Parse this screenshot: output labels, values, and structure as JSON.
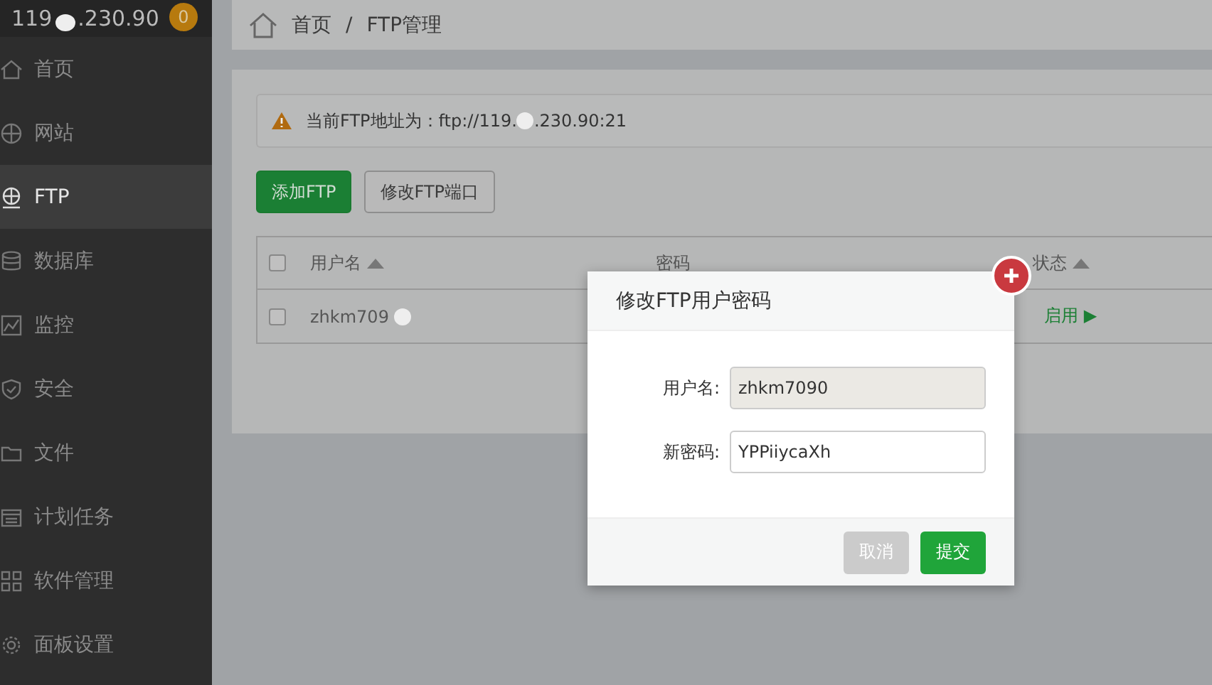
{
  "sidebar": {
    "host": {
      "ip_start": "119",
      "ip_end": ".230.90",
      "badge": "0"
    },
    "items": [
      {
        "label": "首页",
        "selected": false
      },
      {
        "label": "网站",
        "selected": false
      },
      {
        "label": "FTP",
        "selected": true
      },
      {
        "label": "数据库",
        "selected": false
      },
      {
        "label": "监控",
        "selected": false
      },
      {
        "label": "安全",
        "selected": false
      },
      {
        "label": "文件",
        "selected": false
      },
      {
        "label": "计划任务",
        "selected": false
      },
      {
        "label": "软件管理",
        "selected": false
      },
      {
        "label": "面板设置",
        "selected": false
      }
    ]
  },
  "breadcrumb": [
    "首页",
    "/",
    "FTP管理"
  ],
  "alert": {
    "text_start": "当前FTP地址为：ftp://119.",
    "text_end": ".230.90:21"
  },
  "buttons": [
    {
      "label": "添加FTP",
      "kind": "primary"
    },
    {
      "label": "修改FTP端口",
      "kind": "default"
    }
  ],
  "table": {
    "all_checked": false,
    "columns": [
      {
        "label": "用户名",
        "sorted": true
      },
      {
        "label": "密码",
        "sorted": false
      },
      {
        "label": "状态",
        "sorted": true
      }
    ],
    "rows": [
      {
        "checked": false,
        "username": "zhkm709",
        "status": "启用",
        "status_icon": "▶"
      }
    ]
  },
  "dialog": {
    "title": "修改FTP用户密码",
    "fields": [
      {
        "label": "用户名:",
        "value": "zhkm7090",
        "disabled": true
      },
      {
        "label": "新密码:",
        "value": "YPPiiycaXh",
        "disabled": false
      }
    ],
    "buttons": [
      {
        "label": "取消",
        "kind": "cancel"
      },
      {
        "label": "提交",
        "kind": "submit"
      }
    ]
  }
}
